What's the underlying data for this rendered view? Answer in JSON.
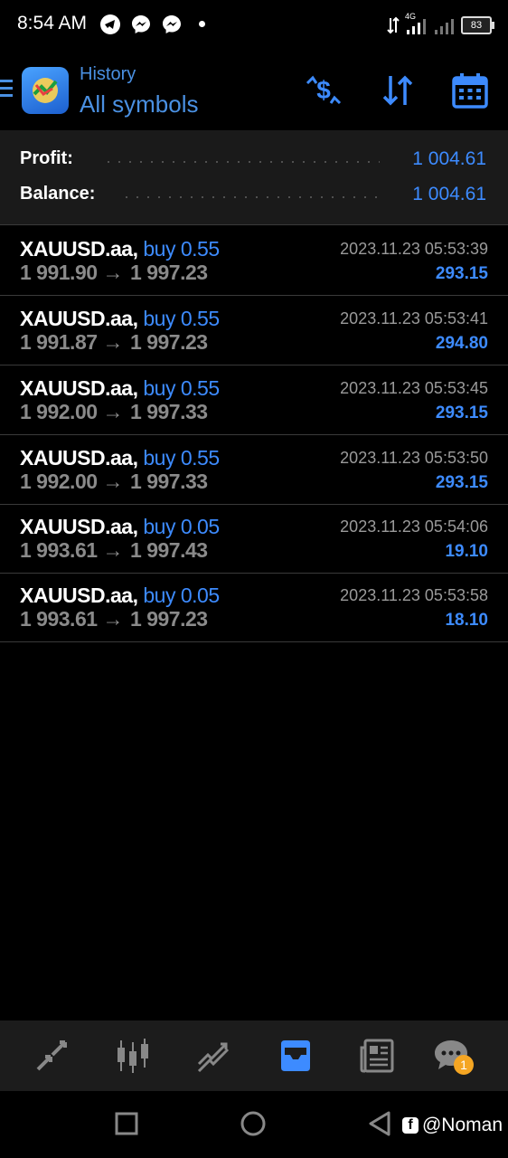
{
  "status_bar": {
    "time": "8:54 AM",
    "network": "4G",
    "battery": "83",
    "icons": [
      "telegram-icon",
      "messenger-icon",
      "messenger-icon"
    ]
  },
  "header": {
    "title_small": "History",
    "title_big": "All symbols",
    "buttons": [
      "deposit-withdraw-icon",
      "sort-icon",
      "calendar-icon"
    ]
  },
  "summary": {
    "profit_label": "Profit:",
    "profit_value": "1 004.61",
    "balance_label": "Balance:",
    "balance_value": "1 004.61"
  },
  "trades": [
    {
      "symbol": "XAUUSD.aa,",
      "type": "buy 0.55",
      "open": "1 991.90",
      "close": "1 997.23",
      "time": "2023.11.23 05:53:39",
      "profit": "293.15"
    },
    {
      "symbol": "XAUUSD.aa,",
      "type": "buy 0.55",
      "open": "1 991.87",
      "close": "1 997.23",
      "time": "2023.11.23 05:53:41",
      "profit": "294.80"
    },
    {
      "symbol": "XAUUSD.aa,",
      "type": "buy 0.55",
      "open": "1 992.00",
      "close": "1 997.33",
      "time": "2023.11.23 05:53:45",
      "profit": "293.15"
    },
    {
      "symbol": "XAUUSD.aa,",
      "type": "buy 0.55",
      "open": "1 992.00",
      "close": "1 997.33",
      "time": "2023.11.23 05:53:50",
      "profit": "293.15"
    },
    {
      "symbol": "XAUUSD.aa,",
      "type": "buy 0.05",
      "open": "1 993.61",
      "close": "1 997.43",
      "time": "2023.11.23 05:54:06",
      "profit": "19.10"
    },
    {
      "symbol": "XAUUSD.aa,",
      "type": "buy 0.05",
      "open": "1 993.61",
      "close": "1 997.23",
      "time": "2023.11.23 05:53:58",
      "profit": "18.10"
    }
  ],
  "trade_arrow": "→",
  "bottom_nav": {
    "items": [
      "quotes-icon",
      "chart-icon",
      "trade-icon",
      "history-icon",
      "news-icon",
      "chat-icon"
    ],
    "active": "history-icon",
    "chat_badge": "1"
  },
  "watermark": "@Noman",
  "colors": {
    "accent": "#3d8bff",
    "background": "#000000",
    "summary_bg": "#1a1a1a",
    "badge": "#f5a623"
  }
}
